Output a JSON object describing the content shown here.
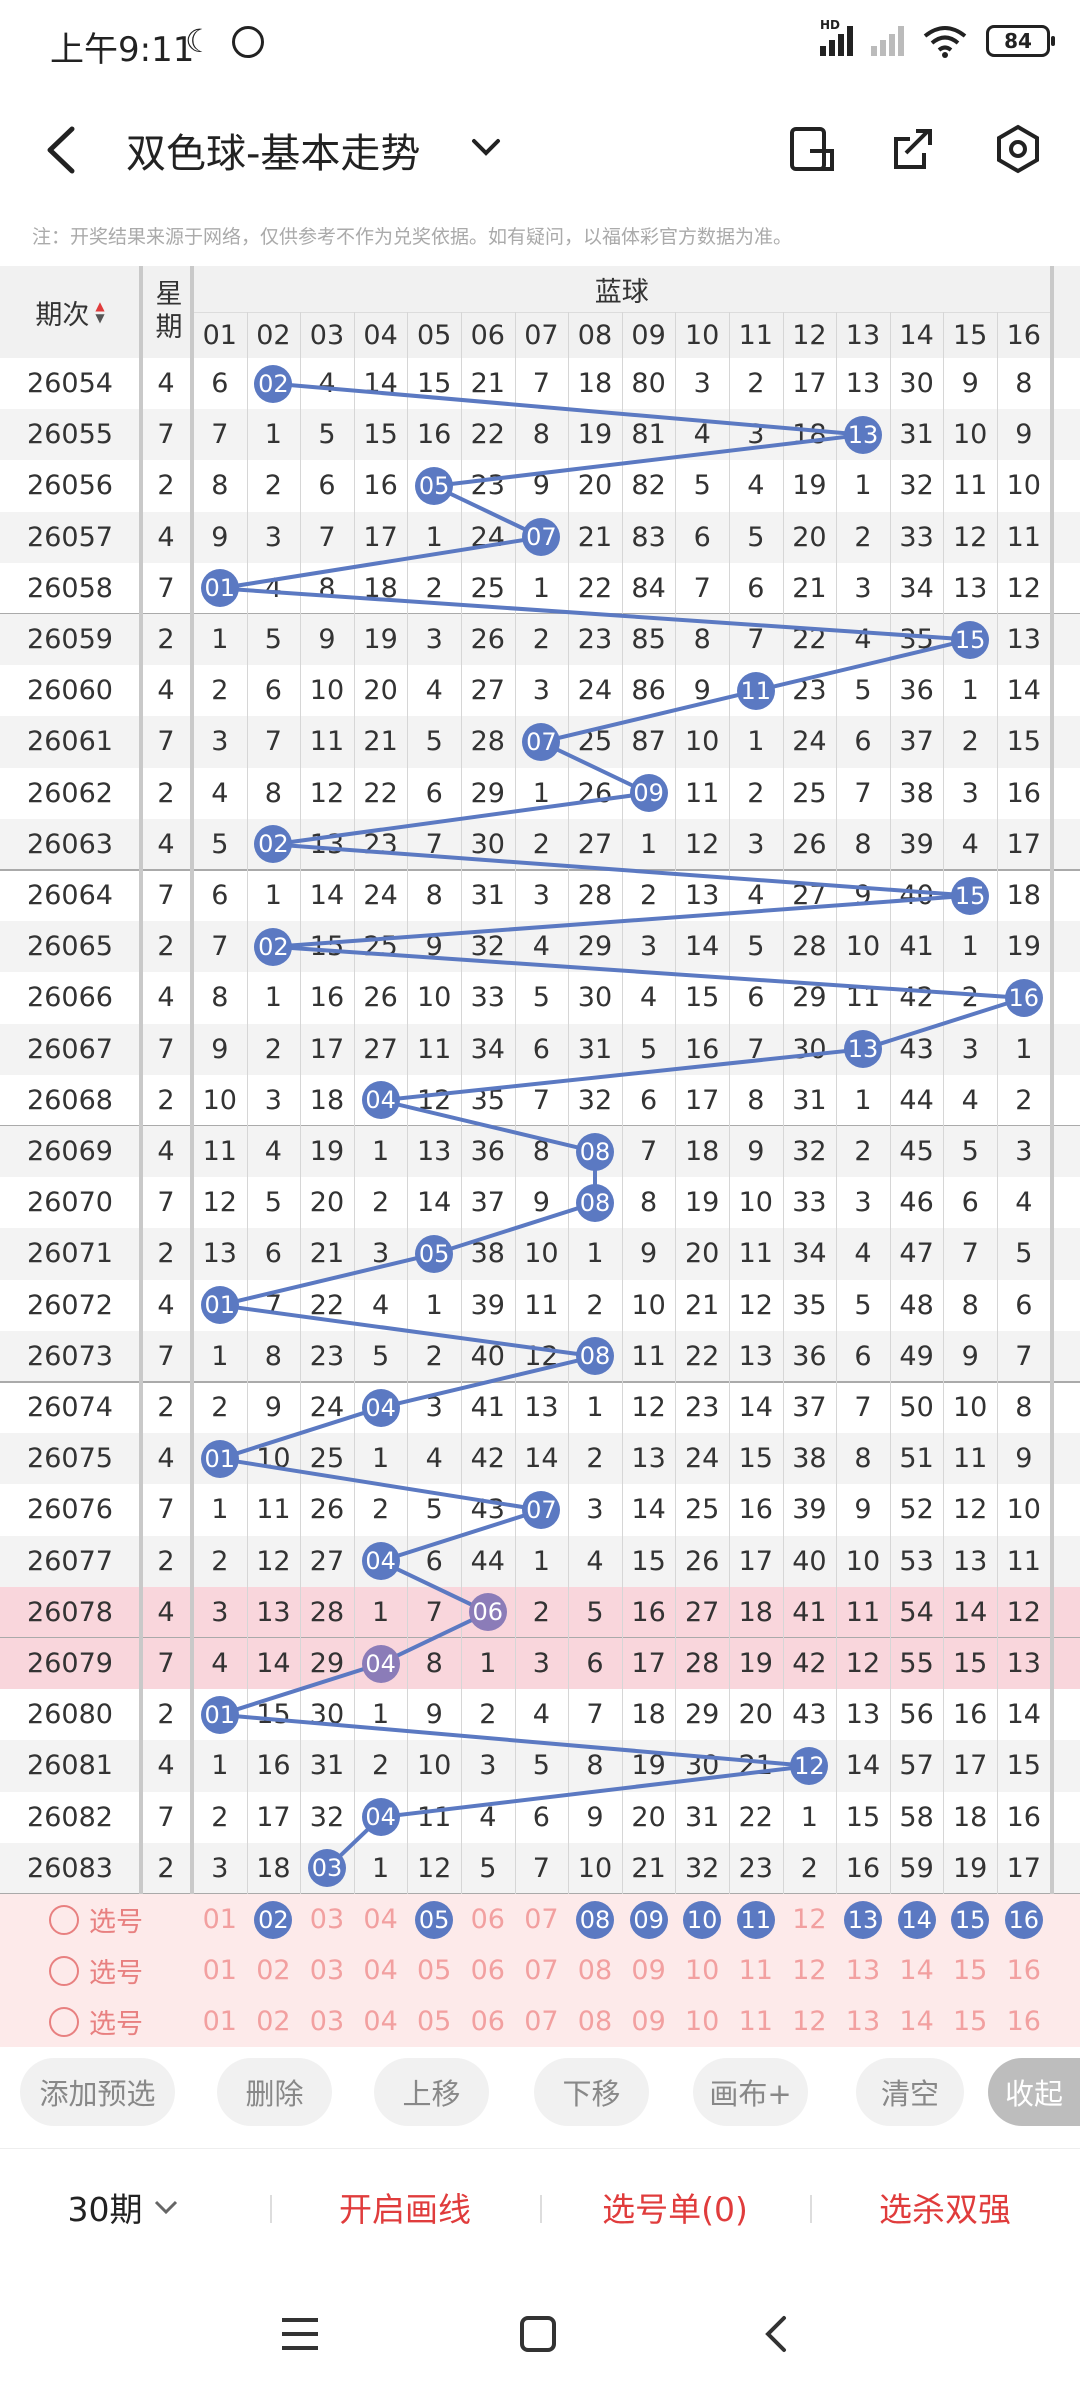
{
  "status_bar": {
    "time": "上午9:11",
    "network_label": "HD",
    "battery": "84"
  },
  "header": {
    "title": "双色球-基本走势"
  },
  "note": "注：开奖结果来源于网络，仅供参考不作为兑奖依据。如有疑问，以福体彩官方数据为准。",
  "table": {
    "col_period": "期次",
    "col_weekday": "星期",
    "group_label": "蓝球",
    "blue_columns": [
      "01",
      "02",
      "03",
      "04",
      "05",
      "06",
      "07",
      "08",
      "09",
      "10",
      "11",
      "12",
      "13",
      "14",
      "15",
      "16"
    ],
    "rows": [
      {
        "period": "26054",
        "weekday": "4",
        "cells": [
          "6",
          "02",
          "4",
          "14",
          "15",
          "21",
          "7",
          "18",
          "80",
          "3",
          "2",
          "17",
          "13",
          "30",
          "9",
          "8"
        ],
        "hit": 2
      },
      {
        "period": "26055",
        "weekday": "7",
        "cells": [
          "7",
          "1",
          "5",
          "15",
          "16",
          "22",
          "8",
          "19",
          "81",
          "4",
          "3",
          "18",
          "13",
          "31",
          "10",
          "9"
        ],
        "hit": 13
      },
      {
        "period": "26056",
        "weekday": "2",
        "cells": [
          "8",
          "2",
          "6",
          "16",
          "05",
          "23",
          "9",
          "20",
          "82",
          "5",
          "4",
          "19",
          "1",
          "32",
          "11",
          "10"
        ],
        "hit": 5
      },
      {
        "period": "26057",
        "weekday": "4",
        "cells": [
          "9",
          "3",
          "7",
          "17",
          "1",
          "24",
          "07",
          "21",
          "83",
          "6",
          "5",
          "20",
          "2",
          "33",
          "12",
          "11"
        ],
        "hit": 7
      },
      {
        "period": "26058",
        "weekday": "7",
        "cells": [
          "01",
          "4",
          "8",
          "18",
          "2",
          "25",
          "1",
          "22",
          "84",
          "7",
          "6",
          "21",
          "3",
          "34",
          "13",
          "12"
        ],
        "hit": 1
      },
      {
        "period": "26059",
        "weekday": "2",
        "cells": [
          "1",
          "5",
          "9",
          "19",
          "3",
          "26",
          "2",
          "23",
          "85",
          "8",
          "7",
          "22",
          "4",
          "35",
          "15",
          "13"
        ],
        "hit": 15
      },
      {
        "period": "26060",
        "weekday": "4",
        "cells": [
          "2",
          "6",
          "10",
          "20",
          "4",
          "27",
          "3",
          "24",
          "86",
          "9",
          "11",
          "23",
          "5",
          "36",
          "1",
          "14"
        ],
        "hit": 11
      },
      {
        "period": "26061",
        "weekday": "7",
        "cells": [
          "3",
          "7",
          "11",
          "21",
          "5",
          "28",
          "07",
          "25",
          "87",
          "10",
          "1",
          "24",
          "6",
          "37",
          "2",
          "15"
        ],
        "hit": 7
      },
      {
        "period": "26062",
        "weekday": "2",
        "cells": [
          "4",
          "8",
          "12",
          "22",
          "6",
          "29",
          "1",
          "26",
          "09",
          "11",
          "2",
          "25",
          "7",
          "38",
          "3",
          "16"
        ],
        "hit": 9
      },
      {
        "period": "26063",
        "weekday": "4",
        "cells": [
          "5",
          "02",
          "13",
          "23",
          "7",
          "30",
          "2",
          "27",
          "1",
          "12",
          "3",
          "26",
          "8",
          "39",
          "4",
          "17"
        ],
        "hit": 2
      },
      {
        "period": "26064",
        "weekday": "7",
        "cells": [
          "6",
          "1",
          "14",
          "24",
          "8",
          "31",
          "3",
          "28",
          "2",
          "13",
          "4",
          "27",
          "9",
          "40",
          "15",
          "18"
        ],
        "hit": 15
      },
      {
        "period": "26065",
        "weekday": "2",
        "cells": [
          "7",
          "02",
          "15",
          "25",
          "9",
          "32",
          "4",
          "29",
          "3",
          "14",
          "5",
          "28",
          "10",
          "41",
          "1",
          "19"
        ],
        "hit": 2
      },
      {
        "period": "26066",
        "weekday": "4",
        "cells": [
          "8",
          "1",
          "16",
          "26",
          "10",
          "33",
          "5",
          "30",
          "4",
          "15",
          "6",
          "29",
          "11",
          "42",
          "2",
          "16"
        ],
        "hit": 16
      },
      {
        "period": "26067",
        "weekday": "7",
        "cells": [
          "9",
          "2",
          "17",
          "27",
          "11",
          "34",
          "6",
          "31",
          "5",
          "16",
          "7",
          "30",
          "13",
          "43",
          "3",
          "1"
        ],
        "hit": 13
      },
      {
        "period": "26068",
        "weekday": "2",
        "cells": [
          "10",
          "3",
          "18",
          "04",
          "12",
          "35",
          "7",
          "32",
          "6",
          "17",
          "8",
          "31",
          "1",
          "44",
          "4",
          "2"
        ],
        "hit": 4
      },
      {
        "period": "26069",
        "weekday": "4",
        "cells": [
          "11",
          "4",
          "19",
          "1",
          "13",
          "36",
          "8",
          "08",
          "7",
          "18",
          "9",
          "32",
          "2",
          "45",
          "5",
          "3"
        ],
        "hit": 8
      },
      {
        "period": "26070",
        "weekday": "7",
        "cells": [
          "12",
          "5",
          "20",
          "2",
          "14",
          "37",
          "9",
          "08",
          "8",
          "19",
          "10",
          "33",
          "3",
          "46",
          "6",
          "4"
        ],
        "hit": 8
      },
      {
        "period": "26071",
        "weekday": "2",
        "cells": [
          "13",
          "6",
          "21",
          "3",
          "05",
          "38",
          "10",
          "1",
          "9",
          "20",
          "11",
          "34",
          "4",
          "47",
          "7",
          "5"
        ],
        "hit": 5
      },
      {
        "period": "26072",
        "weekday": "4",
        "cells": [
          "01",
          "7",
          "22",
          "4",
          "1",
          "39",
          "11",
          "2",
          "10",
          "21",
          "12",
          "35",
          "5",
          "48",
          "8",
          "6"
        ],
        "hit": 1
      },
      {
        "period": "26073",
        "weekday": "7",
        "cells": [
          "1",
          "8",
          "23",
          "5",
          "2",
          "40",
          "12",
          "08",
          "11",
          "22",
          "13",
          "36",
          "6",
          "49",
          "9",
          "7"
        ],
        "hit": 8
      },
      {
        "period": "26074",
        "weekday": "2",
        "cells": [
          "2",
          "9",
          "24",
          "04",
          "3",
          "41",
          "13",
          "1",
          "12",
          "23",
          "14",
          "37",
          "7",
          "50",
          "10",
          "8"
        ],
        "hit": 4
      },
      {
        "period": "26075",
        "weekday": "4",
        "cells": [
          "01",
          "10",
          "25",
          "1",
          "4",
          "42",
          "14",
          "2",
          "13",
          "24",
          "15",
          "38",
          "8",
          "51",
          "11",
          "9"
        ],
        "hit": 1
      },
      {
        "period": "26076",
        "weekday": "7",
        "cells": [
          "1",
          "11",
          "26",
          "2",
          "5",
          "43",
          "07",
          "3",
          "14",
          "25",
          "16",
          "39",
          "9",
          "52",
          "12",
          "10"
        ],
        "hit": 7
      },
      {
        "period": "26077",
        "weekday": "2",
        "cells": [
          "2",
          "12",
          "27",
          "04",
          "6",
          "44",
          "1",
          "4",
          "15",
          "26",
          "17",
          "40",
          "10",
          "53",
          "13",
          "11"
        ],
        "hit": 4
      },
      {
        "period": "26078",
        "weekday": "4",
        "cells": [
          "3",
          "13",
          "28",
          "1",
          "7",
          "06",
          "2",
          "5",
          "16",
          "27",
          "18",
          "41",
          "11",
          "54",
          "14",
          "12"
        ],
        "hit": 6
      },
      {
        "period": "26079",
        "weekday": "7",
        "cells": [
          "4",
          "14",
          "29",
          "04",
          "8",
          "1",
          "3",
          "6",
          "17",
          "28",
          "19",
          "42",
          "12",
          "55",
          "15",
          "13"
        ],
        "hit": 4
      },
      {
        "period": "26080",
        "weekday": "2",
        "cells": [
          "01",
          "15",
          "30",
          "1",
          "9",
          "2",
          "4",
          "7",
          "18",
          "29",
          "20",
          "43",
          "13",
          "56",
          "16",
          "14"
        ],
        "hit": 1
      },
      {
        "period": "26081",
        "weekday": "4",
        "cells": [
          "1",
          "16",
          "31",
          "2",
          "10",
          "3",
          "5",
          "8",
          "19",
          "30",
          "21",
          "12",
          "14",
          "57",
          "17",
          "15"
        ],
        "hit": 12
      },
      {
        "period": "26082",
        "weekday": "7",
        "cells": [
          "2",
          "17",
          "32",
          "04",
          "11",
          "4",
          "6",
          "9",
          "20",
          "31",
          "22",
          "1",
          "15",
          "58",
          "18",
          "16"
        ],
        "hit": 4
      },
      {
        "period": "26083",
        "weekday": "2",
        "cells": [
          "3",
          "18",
          "03",
          "1",
          "12",
          "5",
          "7",
          "10",
          "21",
          "32",
          "23",
          "2",
          "16",
          "59",
          "19",
          "17"
        ],
        "hit": 3
      }
    ],
    "select_rows": [
      {
        "label": "选号",
        "selected": [
          2,
          5,
          8,
          9,
          10,
          11,
          13,
          14,
          15,
          16
        ]
      },
      {
        "label": "选号",
        "selected": []
      },
      {
        "label": "选号",
        "selected": []
      }
    ]
  },
  "toolbar": {
    "buttons": [
      "添加预选",
      "删除",
      "上移",
      "下移",
      "画布+",
      "清空"
    ],
    "collapse": "收起"
  },
  "actions": {
    "period_select": "30期",
    "draw_line": "开启画线",
    "selection_list": "选号单(0)",
    "kill_strong": "选杀双强"
  },
  "colors": {
    "ball_blue": "#5b79c2",
    "ball_purple": "#8b7cb8",
    "highlight_row": "#f9d6dc",
    "accent_red": "#e03c3c",
    "select_row_bg": "#fdeaea"
  }
}
